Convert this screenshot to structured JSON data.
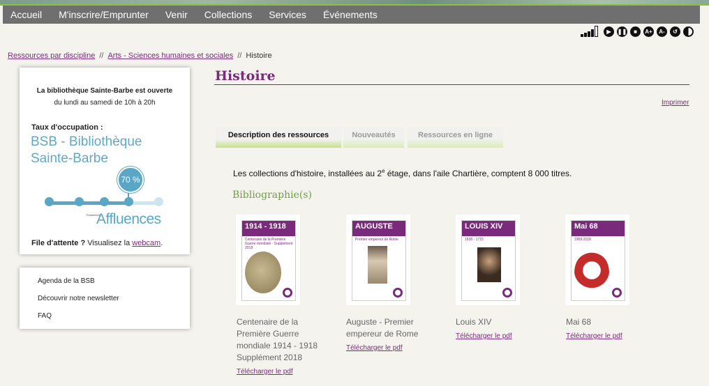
{
  "nav": {
    "items": [
      "Accueil",
      "M'inscrire/Emprunter",
      "Venir",
      "Collections",
      "Services",
      "Événements"
    ]
  },
  "accessibility": {
    "buttons": [
      "A+",
      "A-"
    ]
  },
  "breadcrumb": {
    "items": [
      "Ressources par discipline",
      "Arts - Sciences humaines et sociales",
      "Histoire"
    ],
    "separator": "//"
  },
  "occupancy": {
    "open_line1": "La bibliothèque Sainte-Barbe est ouverte",
    "open_line2": "du lundi au samedi de 10h à 20h",
    "taux_label": "Taux d'occupation :",
    "library_line1": "BSB - Bibliothèque",
    "library_line2": "Sainte-Barbe",
    "percent": 70,
    "percent_label": "70 %",
    "powered": "Powered by",
    "brand": "Affluences",
    "wait_bold": "File d'attente ?",
    "wait_text": " Visualisez la ",
    "wait_link": "webcam",
    "wait_end": "."
  },
  "sidelinks": [
    "Agenda de la BSB",
    "Découvrir notre newsletter",
    "FAQ"
  ],
  "page": {
    "title": "Histoire",
    "print": "Imprimer",
    "tabs": [
      "Description des ressources",
      "Nouveautés",
      "Ressources en ligne"
    ],
    "desc_pre": "Les collections d'histoire, installées au 2",
    "desc_sup": "e",
    "desc_post": " étage, dans l'aile Chartière, comptent 8 000 titres.",
    "bib_heading": "Bibliographie(s)"
  },
  "books": [
    {
      "cover": "1914 - 1918",
      "cover_sub": "Centenaire de la Première Guerre mondiale · Supplément 2018",
      "title_lines": [
        "Centenaire de la",
        "Première Guerre",
        "mondiale 1914 - 1918",
        "Supplément 2018"
      ],
      "download": "Télécharger le pdf"
    },
    {
      "cover": "AUGUSTE",
      "cover_sub": "Premier empereur de Rome",
      "title_lines": [
        "Auguste - Premier",
        "empereur de Rome"
      ],
      "download": "Télécharger le pdf"
    },
    {
      "cover": "LOUIS XIV",
      "cover_sub": "1638 - 1715",
      "title_lines": [
        "Louis XIV"
      ],
      "download": "Télécharger le pdf"
    },
    {
      "cover": "Mai 68",
      "cover_sub": "1968-2018",
      "title_lines": [
        "Mai 68"
      ],
      "download": "Télécharger le pdf"
    }
  ],
  "colors": {
    "brand": "#7a2a7a",
    "green": "#6aa23e",
    "affluences": "#5aa6c7",
    "nav": "#6f6f6f"
  }
}
